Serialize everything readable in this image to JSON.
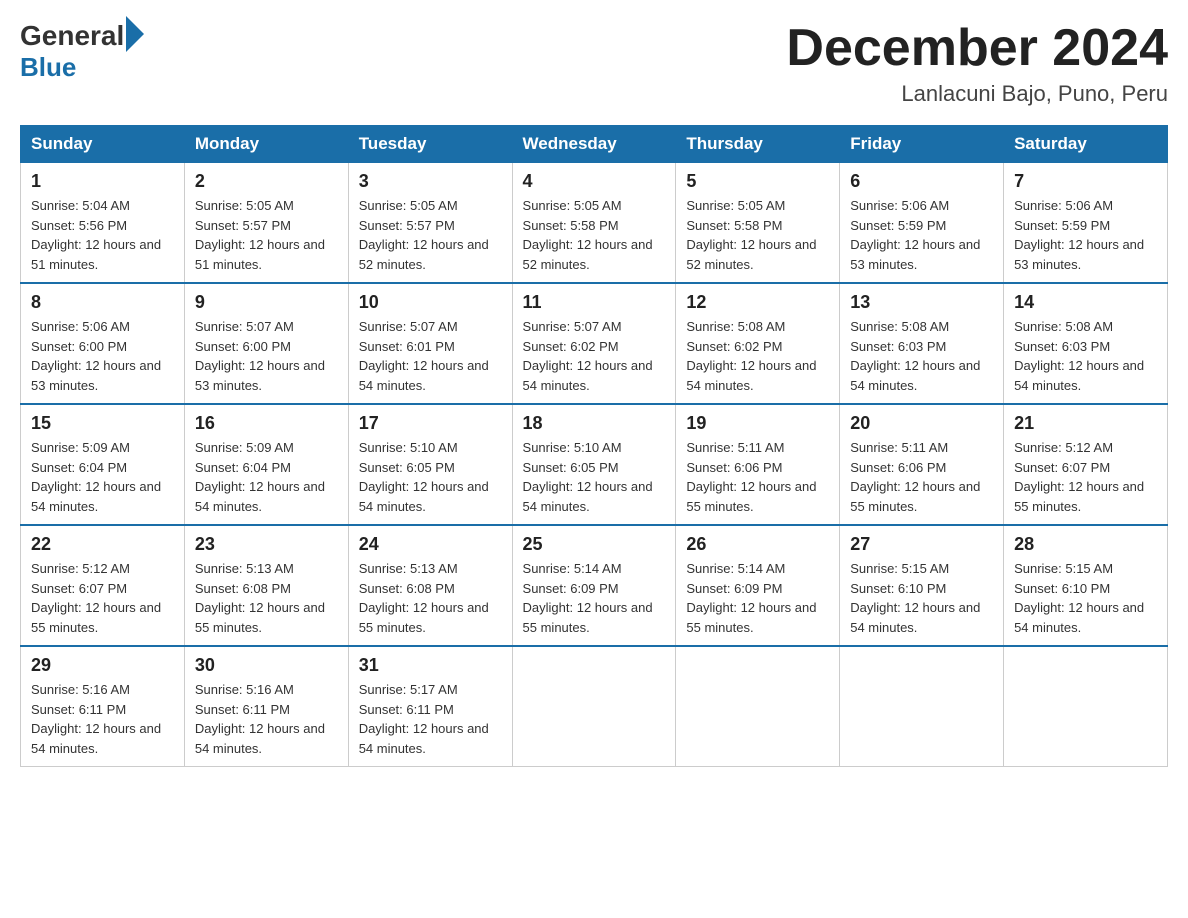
{
  "header": {
    "logo_general": "General",
    "logo_blue": "Blue",
    "title": "December 2024",
    "subtitle": "Lanlacuni Bajo, Puno, Peru"
  },
  "weekdays": [
    "Sunday",
    "Monday",
    "Tuesday",
    "Wednesday",
    "Thursday",
    "Friday",
    "Saturday"
  ],
  "weeks": [
    [
      {
        "day": "1",
        "sunrise": "5:04 AM",
        "sunset": "5:56 PM",
        "daylight": "12 hours and 51 minutes."
      },
      {
        "day": "2",
        "sunrise": "5:05 AM",
        "sunset": "5:57 PM",
        "daylight": "12 hours and 51 minutes."
      },
      {
        "day": "3",
        "sunrise": "5:05 AM",
        "sunset": "5:57 PM",
        "daylight": "12 hours and 52 minutes."
      },
      {
        "day": "4",
        "sunrise": "5:05 AM",
        "sunset": "5:58 PM",
        "daylight": "12 hours and 52 minutes."
      },
      {
        "day": "5",
        "sunrise": "5:05 AM",
        "sunset": "5:58 PM",
        "daylight": "12 hours and 52 minutes."
      },
      {
        "day": "6",
        "sunrise": "5:06 AM",
        "sunset": "5:59 PM",
        "daylight": "12 hours and 53 minutes."
      },
      {
        "day": "7",
        "sunrise": "5:06 AM",
        "sunset": "5:59 PM",
        "daylight": "12 hours and 53 minutes."
      }
    ],
    [
      {
        "day": "8",
        "sunrise": "5:06 AM",
        "sunset": "6:00 PM",
        "daylight": "12 hours and 53 minutes."
      },
      {
        "day": "9",
        "sunrise": "5:07 AM",
        "sunset": "6:00 PM",
        "daylight": "12 hours and 53 minutes."
      },
      {
        "day": "10",
        "sunrise": "5:07 AM",
        "sunset": "6:01 PM",
        "daylight": "12 hours and 54 minutes."
      },
      {
        "day": "11",
        "sunrise": "5:07 AM",
        "sunset": "6:02 PM",
        "daylight": "12 hours and 54 minutes."
      },
      {
        "day": "12",
        "sunrise": "5:08 AM",
        "sunset": "6:02 PM",
        "daylight": "12 hours and 54 minutes."
      },
      {
        "day": "13",
        "sunrise": "5:08 AM",
        "sunset": "6:03 PM",
        "daylight": "12 hours and 54 minutes."
      },
      {
        "day": "14",
        "sunrise": "5:08 AM",
        "sunset": "6:03 PM",
        "daylight": "12 hours and 54 minutes."
      }
    ],
    [
      {
        "day": "15",
        "sunrise": "5:09 AM",
        "sunset": "6:04 PM",
        "daylight": "12 hours and 54 minutes."
      },
      {
        "day": "16",
        "sunrise": "5:09 AM",
        "sunset": "6:04 PM",
        "daylight": "12 hours and 54 minutes."
      },
      {
        "day": "17",
        "sunrise": "5:10 AM",
        "sunset": "6:05 PM",
        "daylight": "12 hours and 54 minutes."
      },
      {
        "day": "18",
        "sunrise": "5:10 AM",
        "sunset": "6:05 PM",
        "daylight": "12 hours and 54 minutes."
      },
      {
        "day": "19",
        "sunrise": "5:11 AM",
        "sunset": "6:06 PM",
        "daylight": "12 hours and 55 minutes."
      },
      {
        "day": "20",
        "sunrise": "5:11 AM",
        "sunset": "6:06 PM",
        "daylight": "12 hours and 55 minutes."
      },
      {
        "day": "21",
        "sunrise": "5:12 AM",
        "sunset": "6:07 PM",
        "daylight": "12 hours and 55 minutes."
      }
    ],
    [
      {
        "day": "22",
        "sunrise": "5:12 AM",
        "sunset": "6:07 PM",
        "daylight": "12 hours and 55 minutes."
      },
      {
        "day": "23",
        "sunrise": "5:13 AM",
        "sunset": "6:08 PM",
        "daylight": "12 hours and 55 minutes."
      },
      {
        "day": "24",
        "sunrise": "5:13 AM",
        "sunset": "6:08 PM",
        "daylight": "12 hours and 55 minutes."
      },
      {
        "day": "25",
        "sunrise": "5:14 AM",
        "sunset": "6:09 PM",
        "daylight": "12 hours and 55 minutes."
      },
      {
        "day": "26",
        "sunrise": "5:14 AM",
        "sunset": "6:09 PM",
        "daylight": "12 hours and 55 minutes."
      },
      {
        "day": "27",
        "sunrise": "5:15 AM",
        "sunset": "6:10 PM",
        "daylight": "12 hours and 54 minutes."
      },
      {
        "day": "28",
        "sunrise": "5:15 AM",
        "sunset": "6:10 PM",
        "daylight": "12 hours and 54 minutes."
      }
    ],
    [
      {
        "day": "29",
        "sunrise": "5:16 AM",
        "sunset": "6:11 PM",
        "daylight": "12 hours and 54 minutes."
      },
      {
        "day": "30",
        "sunrise": "5:16 AM",
        "sunset": "6:11 PM",
        "daylight": "12 hours and 54 minutes."
      },
      {
        "day": "31",
        "sunrise": "5:17 AM",
        "sunset": "6:11 PM",
        "daylight": "12 hours and 54 minutes."
      },
      null,
      null,
      null,
      null
    ]
  ]
}
